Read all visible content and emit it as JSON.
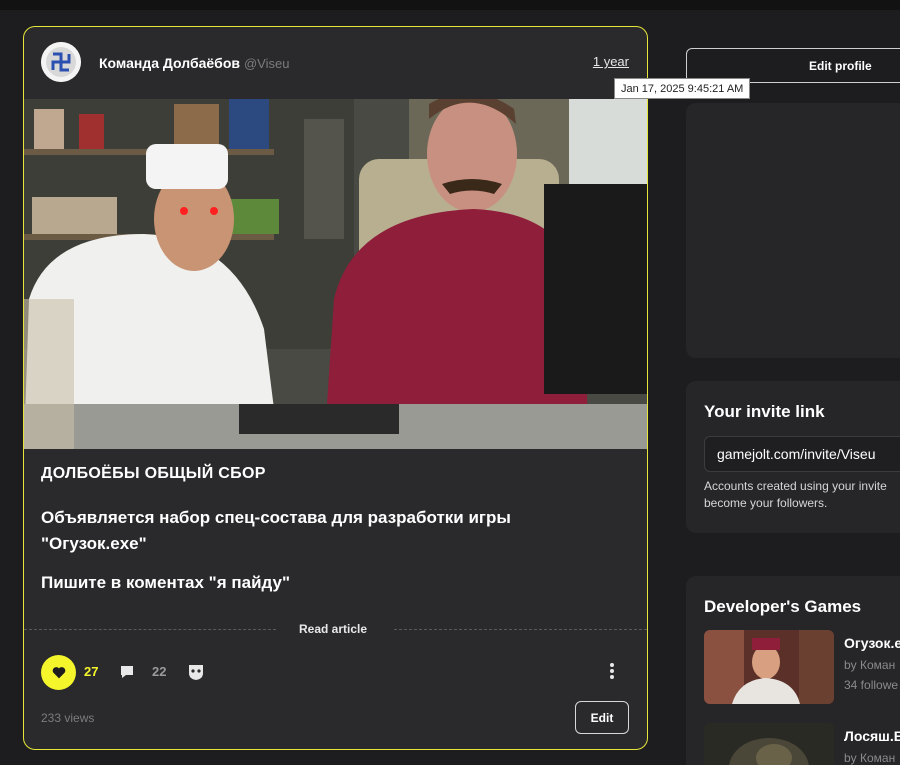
{
  "post": {
    "author_name": "Команда Долбаёбов",
    "author_handle": "@Viseu",
    "time": "1 year",
    "tooltip": "Jan 17, 2025 9:45:21 AM",
    "title": "ДОЛБОЁБЫ ОБЩЫЙ СБОР",
    "body_1": "Объявляется набор спец-состава для разработки игры \"Огузок.exe\"",
    "body_2": "Пишите в коментах \"я пайду\"",
    "read_article": "Read article",
    "likes": "27",
    "comments": "22",
    "views": "233 views",
    "edit_label": "Edit",
    "accent_color": "#f5f52c"
  },
  "sidebar": {
    "edit_profile_label": "Edit profile",
    "invite": {
      "title": "Your invite link",
      "link": "gamejolt.com/invite/Viseu",
      "note": "Accounts created using your invite become your followers."
    },
    "developer_games": {
      "title": "Developer's Games",
      "games": [
        {
          "name": "Огузок.e",
          "by": "by Коман",
          "followers": "34 followe"
        },
        {
          "name": "Лосяш.E",
          "by": "by Коман",
          "followers": ""
        }
      ]
    }
  }
}
